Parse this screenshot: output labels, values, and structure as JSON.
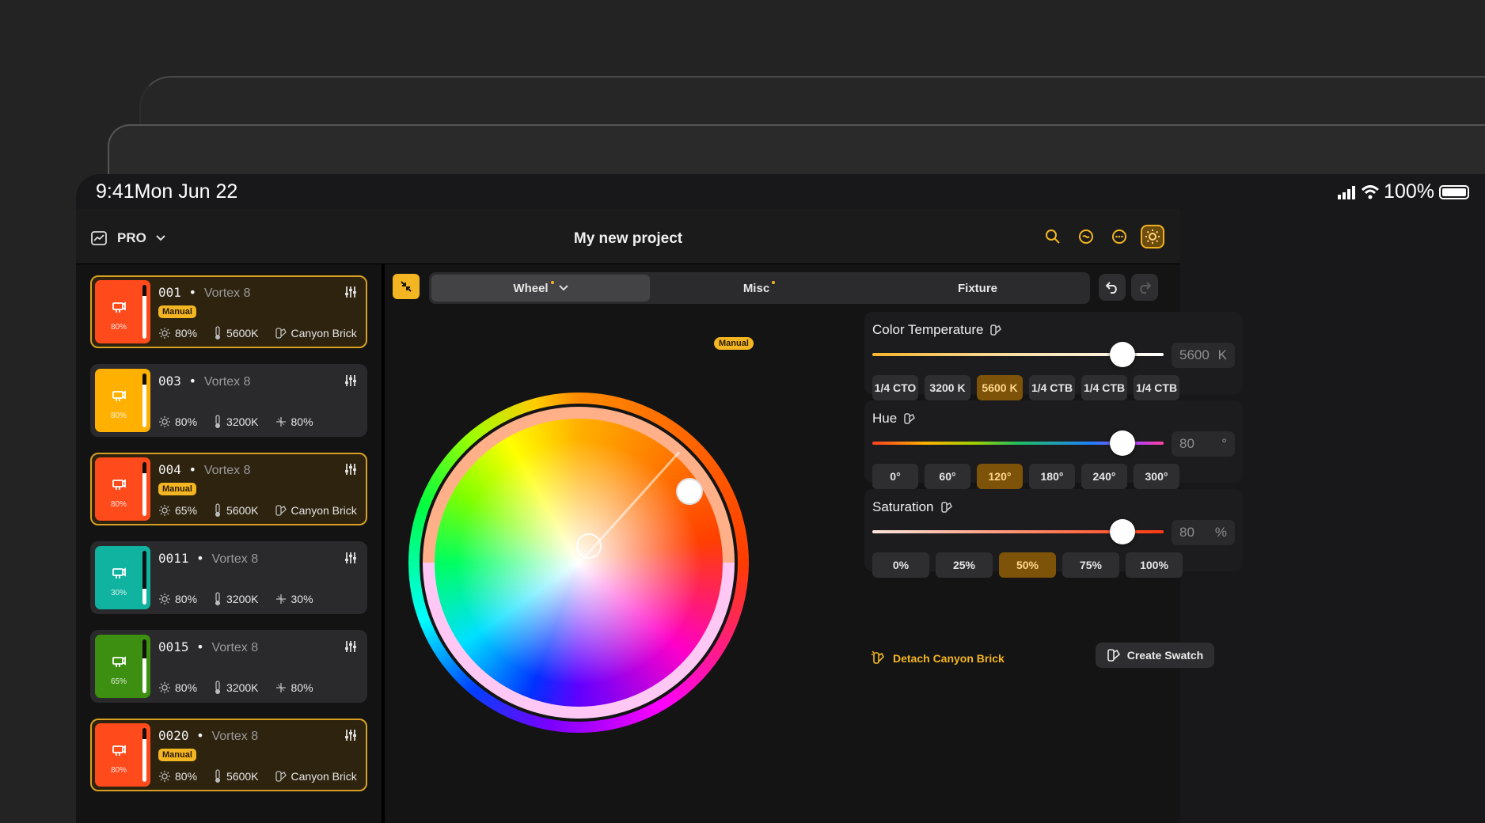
{
  "status_bar": {
    "time": "9:41",
    "date": "Mon Jun 22",
    "battery": "100%",
    "signal_icon": "cellular-signal-icon",
    "wifi_icon": "wifi-icon"
  },
  "header": {
    "mode_label": "PRO",
    "project_title": "My new project",
    "icons": [
      "search-icon",
      "minus-circle-icon",
      "more-circle-icon",
      "brightness-settings-icon"
    ]
  },
  "fixtures": [
    {
      "number": "001",
      "model": "Vortex 8",
      "color": "#ff4a1c",
      "level": 0.8,
      "pct": "80%",
      "manual": true,
      "manual_label": "Manual",
      "intensity": "80%",
      "cct": "5600K",
      "extra": "Canyon Brick",
      "extra_icon": "swatch-icon"
    },
    {
      "number": "003",
      "model": "Vortex 8",
      "color": "#ffb000",
      "level": 0.8,
      "pct": "80%",
      "manual": false,
      "manual_label": "",
      "intensity": "80%",
      "cct": "3200K",
      "extra": "80%",
      "extra_icon": "sparkle-icon"
    },
    {
      "number": "004",
      "model": "Vortex 8",
      "color": "#ff4a1c",
      "level": 0.8,
      "pct": "80%",
      "manual": true,
      "manual_label": "Manual",
      "intensity": "65%",
      "cct": "5600K",
      "extra": "Canyon Brick",
      "extra_icon": "swatch-icon"
    },
    {
      "number": "0011",
      "model": "Vortex 8",
      "color": "#10b3a0",
      "level": 0.3,
      "pct": "30%",
      "manual": false,
      "manual_label": "",
      "intensity": "80%",
      "cct": "3200K",
      "extra": "30%",
      "extra_icon": "sparkle-icon"
    },
    {
      "number": "0015",
      "model": "Vortex 8",
      "color": "#3c8f10",
      "level": 0.65,
      "pct": "65%",
      "manual": false,
      "manual_label": "",
      "intensity": "80%",
      "cct": "3200K",
      "extra": "80%",
      "extra_icon": "sparkle-icon"
    },
    {
      "number": "0020",
      "model": "Vortex 8",
      "color": "#ff4a1c",
      "level": 0.8,
      "pct": "80%",
      "manual": true,
      "manual_label": "Manual",
      "intensity": "80%",
      "cct": "5600K",
      "extra": "Canyon Brick",
      "extra_icon": "swatch-icon"
    }
  ],
  "tabs": {
    "wheel": "Wheel",
    "misc": "Misc",
    "fixture": "Fixture"
  },
  "wheel": {
    "manual_label": "Manual",
    "hue_deg": 120,
    "saturation_pct": 50
  },
  "color_temperature": {
    "title": "Color Temperature",
    "value": "5600",
    "unit": "K",
    "level": 0.86,
    "presets": [
      "1/4 CTO",
      "3200 K",
      "5600 K",
      "1/4 CTB",
      "1/4 CTB",
      "1/4 CTB"
    ],
    "active_index": 2
  },
  "hue": {
    "title": "Hue",
    "value": "80",
    "unit": "°",
    "level": 0.86,
    "presets": [
      "0°",
      "60°",
      "120°",
      "180°",
      "240°",
      "300°"
    ],
    "active_index": 2
  },
  "saturation": {
    "title": "Saturation",
    "value": "80",
    "unit": "%",
    "level": 0.86,
    "presets": [
      "0%",
      "25%",
      "50%",
      "75%",
      "100%"
    ],
    "active_index": 2
  },
  "actions": {
    "detach": "Detach Canyon Brick",
    "create_swatch": "Create Swatch"
  },
  "colors": {
    "accent": "#f3b522",
    "active_preset": "#7c5308"
  }
}
